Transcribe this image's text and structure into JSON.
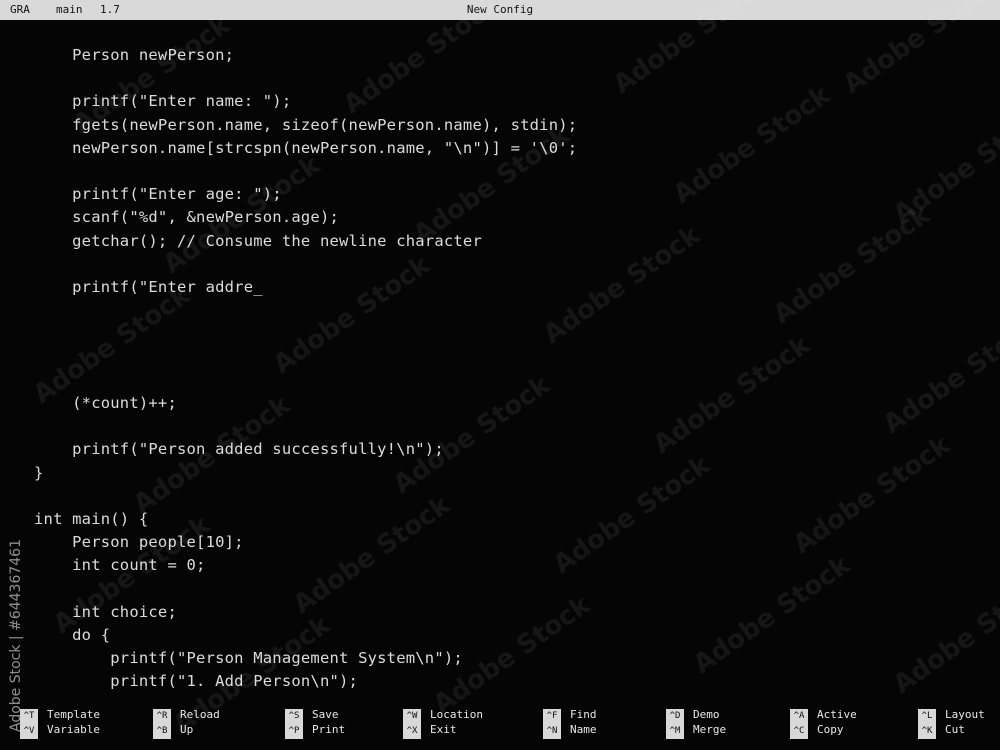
{
  "titlebar": {
    "app": "GRA",
    "branch": "main",
    "version": "1.7",
    "title": "New Config"
  },
  "code": [
    "    Person newPerson;",
    "",
    "    printf(\"Enter name: \");",
    "    fgets(newPerson.name, sizeof(newPerson.name), stdin);",
    "    newPerson.name[strcspn(newPerson.name, \"\\n\")] = '\\0';",
    "",
    "    printf(\"Enter age: \");",
    "    scanf(\"%d\", &newPerson.age);",
    "    getchar(); // Consume the newline character",
    "",
    "    printf(\"Enter addre_",
    "",
    "",
    "",
    "",
    "    (*count)++;",
    "",
    "    printf(\"Person added successfully!\\n\");",
    "}",
    "",
    "int main() {",
    "    Person people[10];",
    "    int count = 0;",
    "",
    "    int choice;",
    "    do {",
    "        printf(\"Person Management System\\n\");",
    "        printf(\"1. Add Person\\n\");"
  ],
  "shortcuts": [
    {
      "key": "^T",
      "label": "Template"
    },
    {
      "key": "^V",
      "label": "Variable"
    },
    {
      "key": "^R",
      "label": "Reload"
    },
    {
      "key": "^B",
      "label": "Up"
    },
    {
      "key": "^S",
      "label": "Save"
    },
    {
      "key": "^P",
      "label": "Print"
    },
    {
      "key": "^W",
      "label": "Location"
    },
    {
      "key": "^X",
      "label": "Exit"
    },
    {
      "key": "^F",
      "label": "Find"
    },
    {
      "key": "^N",
      "label": "Name"
    },
    {
      "key": "^D",
      "label": "Demo"
    },
    {
      "key": "^M",
      "label": "Merge"
    },
    {
      "key": "^A",
      "label": "Active"
    },
    {
      "key": "^C",
      "label": "Copy"
    },
    {
      "key": "^L",
      "label": "Layout"
    },
    {
      "key": "^K",
      "label": "Cut"
    }
  ],
  "watermark": {
    "text": "Adobe Stock",
    "side_text": "Adobe Stock | #644367461"
  }
}
